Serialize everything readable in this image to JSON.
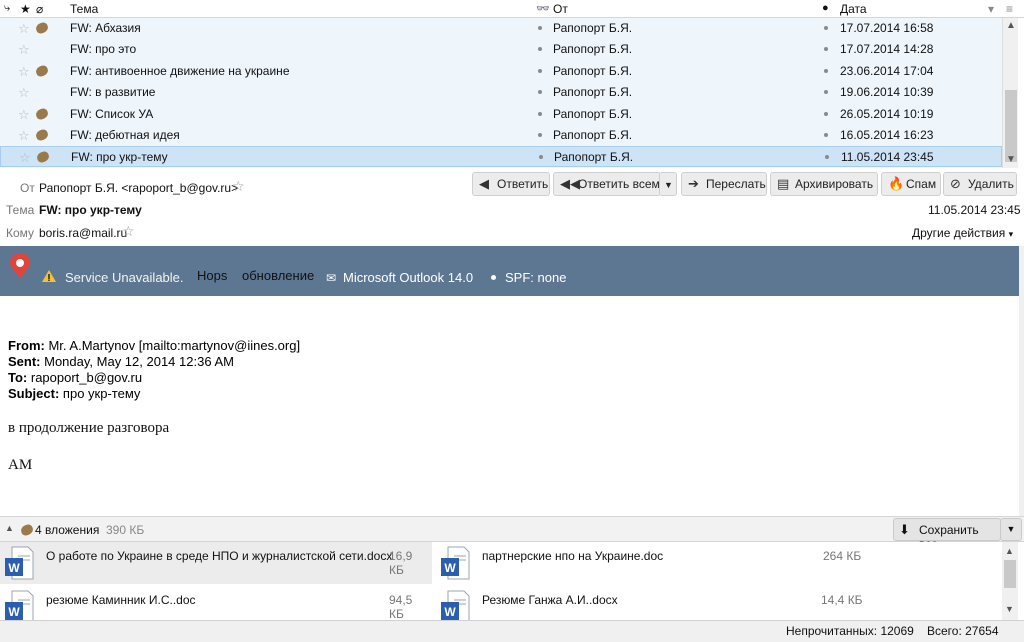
{
  "columns": {
    "subject": "Тема",
    "from": "От",
    "date": "Дата"
  },
  "messages": [
    {
      "subject": "FW: Абхазия",
      "from": "Рапопорт Б.Я.",
      "date": "17.07.2014 16:58",
      "has_attachment": true
    },
    {
      "subject": "FW: про это",
      "from": "Рапопорт Б.Я.",
      "date": "17.07.2014 14:28",
      "has_attachment": false
    },
    {
      "subject": "FW: антивоенное движение на украине",
      "from": "Рапопорт Б.Я.",
      "date": "23.06.2014 17:04",
      "has_attachment": true
    },
    {
      "subject": "FW: в развитие",
      "from": "Рапопорт Б.Я.",
      "date": "19.06.2014 10:39",
      "has_attachment": false
    },
    {
      "subject": "FW: Список УА",
      "from": "Рапопорт Б.Я.",
      "date": "26.05.2014 10:19",
      "has_attachment": true
    },
    {
      "subject": "FW: дебютная идея",
      "from": "Рапопорт Б.Я.",
      "date": "16.05.2014 16:23",
      "has_attachment": true
    },
    {
      "subject": "FW: про укр-тему",
      "from": "Рапопорт Б.Я.",
      "date": "11.05.2014 23:45",
      "has_attachment": true,
      "selected": true
    }
  ],
  "header": {
    "from_label": "От",
    "from_value": "Рапопорт Б.Я. <rapoport_b@gov.ru>",
    "subject_label": "Тема",
    "subject_value": "FW: про укр-тему",
    "to_label": "Кому",
    "to_value": "boris.ra@mail.ru",
    "date": "11.05.2014 23:45",
    "other_actions": "Другие действия"
  },
  "toolbar": {
    "reply": "Ответить",
    "reply_all": "Ответить всем",
    "forward": "Переслать",
    "archive": "Архивировать",
    "spam": "Спам",
    "delete": "Удалить"
  },
  "banner": {
    "service": "Service Unavailable.",
    "hops": "Hops",
    "update": "обновление",
    "client": "Microsoft Outlook 14.0",
    "spf": "SPF: none",
    "background_color": "#5d7793"
  },
  "body": {
    "from_label": "From:",
    "from_value": "Mr. A.Martynov [mailto:martynov@iines.org]",
    "sent_label": "Sent:",
    "sent_value": "Monday, May 12, 2014 12:36 AM",
    "to_label": "To:",
    "to_value": "rapoport_b@gov.ru",
    "subject_label": "Subject:",
    "subject_value": "про укр-тему",
    "line1": "в продолжение разговора",
    "line2": "АМ"
  },
  "attachments": {
    "count_label": "4 вложения",
    "total_size": "390 КБ",
    "save_all": "Сохранить все",
    "items": [
      {
        "name": "О работе по Украине в среде НПО и журналистской сети.docx",
        "size": "16,9 КБ"
      },
      {
        "name": "партнерские нпо на Украине.doc",
        "size": "264 КБ"
      },
      {
        "name": "резюме Каминник И.С..doc",
        "size": "94,5 КБ"
      },
      {
        "name": "Резюме Ганжа А.И..docx",
        "size": "14,4 КБ"
      }
    ]
  },
  "status": {
    "unread": "Непрочитанных: 12069",
    "total": "Всего: 27654"
  }
}
